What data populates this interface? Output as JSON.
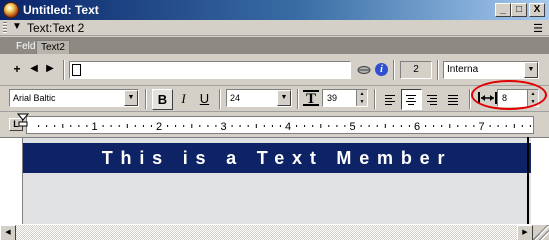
{
  "window": {
    "title": "Untitled: Text",
    "controls": {
      "minimize": "_",
      "maximize": "□",
      "close": "X"
    }
  },
  "panel": {
    "expand_arrow": "▼",
    "title": "Text:Text 2",
    "menu_icon": "☰"
  },
  "tabs": [
    {
      "label": "Feld",
      "active": false
    },
    {
      "label": "Text2",
      "active": true
    }
  ],
  "member_bar": {
    "nav": {
      "new": "+",
      "prev": "◀",
      "next": "▶"
    },
    "member_name": "",
    "cast_number": "2",
    "cast_library": "Interna"
  },
  "format_bar": {
    "font": "Arial Baltic",
    "bold_label": "B",
    "italic_label": "I",
    "underline_label": "U",
    "font_size": "24",
    "leading_icon_label": "T",
    "leading": "39",
    "kerning": "8"
  },
  "ruler": {
    "tab_type_label": "L",
    "numbers": [
      "1",
      "2",
      "3",
      "4",
      "5",
      "6",
      "7"
    ]
  },
  "text_content": "This is a Text Member",
  "colors": {
    "title_bar": "#0a246a",
    "text_background": "#0e2366",
    "highlight_ellipse": "#e00000"
  }
}
